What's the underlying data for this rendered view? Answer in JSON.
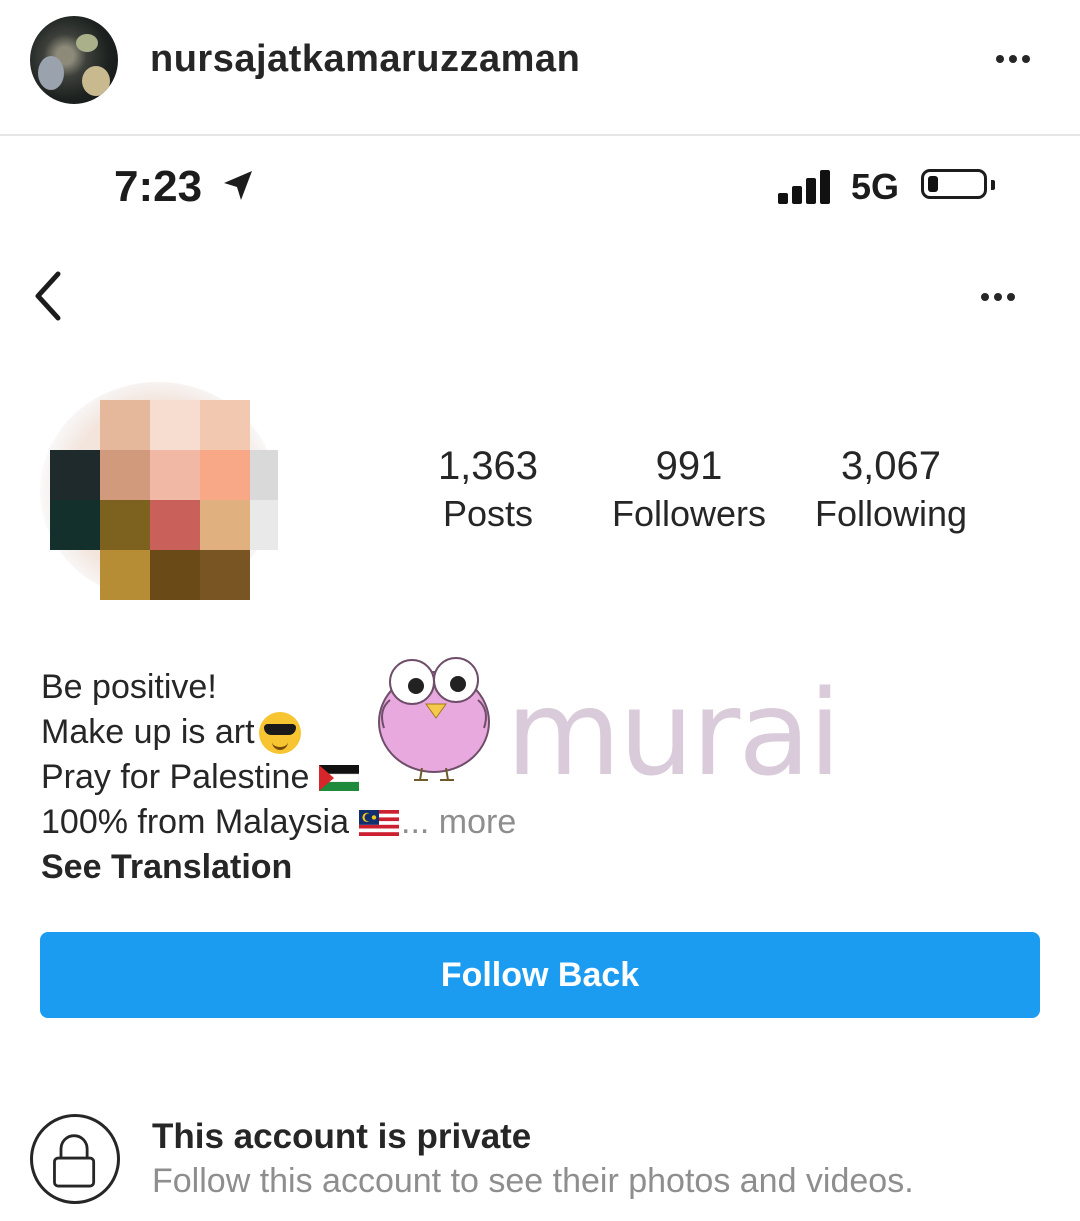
{
  "post_header": {
    "username": "nursajatkamaruzzaman",
    "avatar_icon": "avatar-photo",
    "more_icon": "more-horizontal-icon"
  },
  "status_bar": {
    "time": "7:23",
    "network": "5G",
    "signal_bars": 4,
    "battery_level": 0.2
  },
  "profile": {
    "back_icon": "chevron-left-icon",
    "more_icon": "more-horizontal-icon",
    "stats": [
      {
        "value": "1,363",
        "label": "Posts"
      },
      {
        "value": "991",
        "label": "Followers"
      },
      {
        "value": "3,067",
        "label": "Following"
      }
    ],
    "bio": {
      "line1": "Be positive!",
      "line2": "Make up is art",
      "line3": "Pray for Palestine",
      "line4": "100% from Malaysia",
      "more": "... more",
      "see_translation": "See Translation"
    },
    "follow_button": "Follow Back",
    "private": {
      "title": "This account is private",
      "subtitle": "Follow this account to see their photos and videos."
    }
  },
  "watermark": {
    "text": "murai",
    "color": "#d9cbd9"
  },
  "colors": {
    "accent": "#1b9cf0",
    "secondary_text": "#8e8e8e",
    "primary_text": "#262626"
  }
}
